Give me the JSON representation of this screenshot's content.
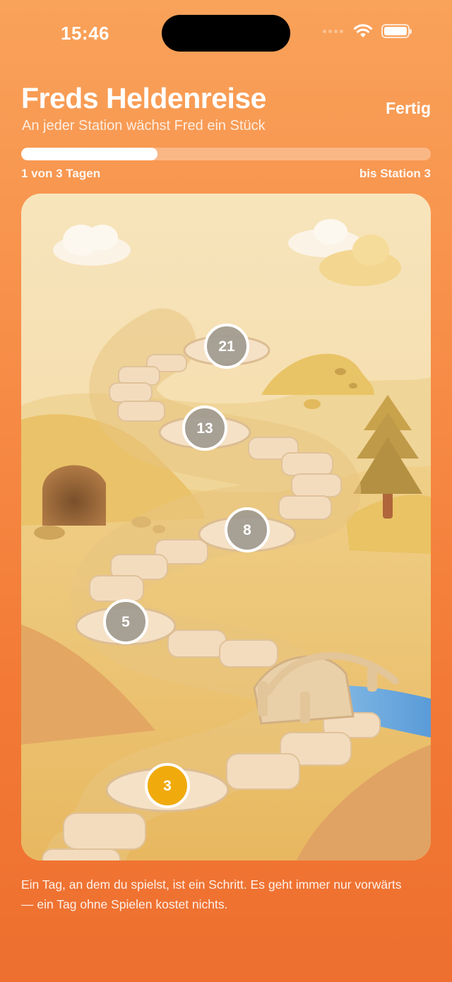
{
  "status_bar": {
    "time": "15:46",
    "icons": [
      "cellular-dots-icon",
      "wifi-icon",
      "battery-icon"
    ]
  },
  "header": {
    "title": "Freds Heldenreise",
    "subtitle": "An jeder Station wächst Fred ein Stück",
    "done_label": "Fertig"
  },
  "progress": {
    "fraction": 0.333,
    "left_label": "1 von 3 Tagen",
    "right_label": "bis Station 3"
  },
  "stations": [
    {
      "number": "21",
      "state": "locked"
    },
    {
      "number": "13",
      "state": "locked"
    },
    {
      "number": "8",
      "state": "locked"
    },
    {
      "number": "5",
      "state": "locked"
    },
    {
      "number": "3",
      "state": "current"
    }
  ],
  "colors": {
    "accent_orange": "#f78e48",
    "current_station": "#f0aa0c",
    "locked_station": "#a09a90"
  },
  "footer": {
    "text": "Ein Tag, an dem du spielst, ist ein Schritt. Es geht immer nur vorwärts — ein Tag ohne Spielen kostet nichts."
  }
}
